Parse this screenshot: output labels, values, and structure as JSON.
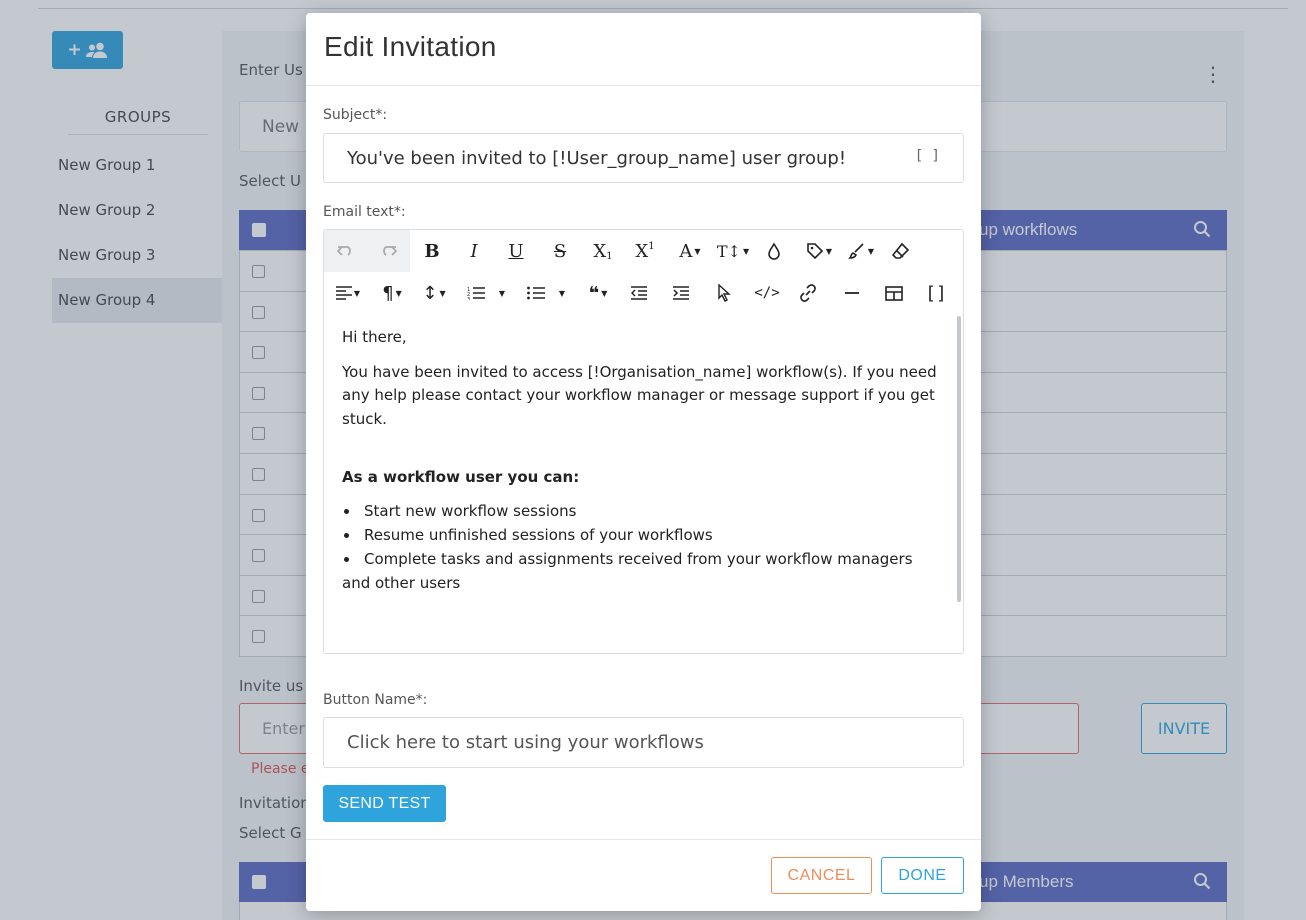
{
  "background": {
    "groups_title": "GROUPS",
    "groups": [
      "New Group 1",
      "New Group 2",
      "New Group 3",
      "New Group 4"
    ],
    "active_group_index": 3,
    "enter_label": "Enter Us",
    "group_name_value": "New",
    "select_users_label": "Select U",
    "users_table_header": "up workflows",
    "invite_label": "Invite us",
    "invite_placeholder": "Enter",
    "invite_button": "INVITE",
    "invite_error": "Please e",
    "invitations_label": "Invitation",
    "select_groups_label": "Select G",
    "members_table_header": "up Members",
    "colors": {
      "primary": "#2ea3dc",
      "table_header": "#5b67c2",
      "error": "#e36a6a"
    }
  },
  "modal": {
    "title": "Edit Invitation",
    "subject_label": "Subject*:",
    "subject_value": "You've been invited to [!User_group_name] user group!",
    "subject_placeholder_icon": "[ ]",
    "email_label": "Email text*:",
    "toolbar": {
      "row1": [
        "undo-icon",
        "redo-icon",
        "bold-icon",
        "italic-icon",
        "underline-icon",
        "strikethrough-icon",
        "subscript-icon",
        "superscript-icon",
        "font-family-icon",
        "font-size-icon",
        "text-color-icon",
        "tag-icon",
        "paint-brush-icon",
        "eraser-icon"
      ],
      "row2": [
        "align-icon",
        "paragraph-icon",
        "line-height-icon",
        "ordered-list-icon",
        "unordered-list-icon",
        "quote-icon",
        "outdent-icon",
        "indent-icon",
        "select-icon",
        "code-icon",
        "link-icon",
        "horizontal-rule-icon",
        "table-icon",
        "brackets-icon"
      ]
    },
    "email_body": {
      "greeting": "Hi there,",
      "intro": "You have been invited to access [!Organisation_name] workflow(s). If you need any help please contact your workflow manager or message support if you get stuck.",
      "list_title": "As a workflow user you can:",
      "list": [
        "Start new workflow sessions",
        "Resume unfinished sessions of your workflows",
        "Complete tasks and assignments received from your workflow managers and other users"
      ]
    },
    "button_name_label": "Button Name*:",
    "button_name_value": "Click here to start using your workflows",
    "send_test": "SEND TEST",
    "cancel": "CANCEL",
    "done": "DONE",
    "colors": {
      "primary": "#2ea3dc",
      "cancel": "#ee8d5a"
    }
  }
}
